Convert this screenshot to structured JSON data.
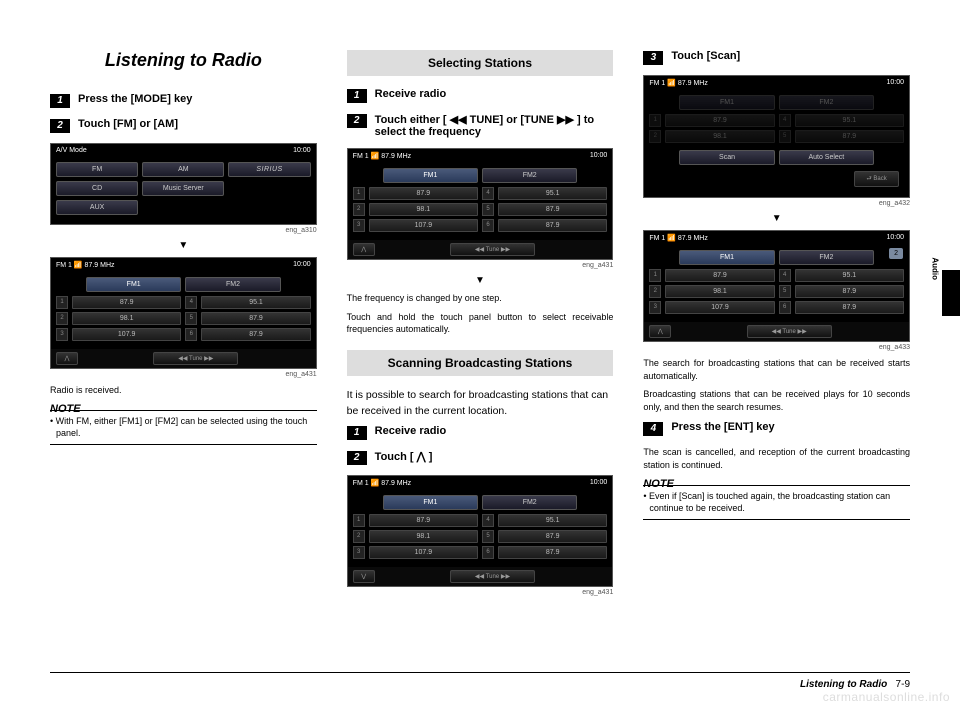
{
  "page": {
    "main_title": "Listening to Radio",
    "footer_title": "Listening to Radio",
    "footer_page": "7-9",
    "side_label": "Audio",
    "watermark": "carmanualsonline.info"
  },
  "col1": {
    "step1": "Press the [MODE] key",
    "step2": "Touch [FM] or [AM]",
    "shot1": {
      "title": "A/V Mode",
      "time": "10:00",
      "btn_fm": "FM",
      "btn_am": "AM",
      "btn_sirius": "SIRIUS",
      "btn_cd": "CD",
      "btn_music": "Music Server",
      "btn_aux": "AUX",
      "caption": "eng_a310"
    },
    "shot2": {
      "title": "FM 1   📶 87.9  MHz",
      "time": "10:00",
      "fm1": "FM1",
      "fm2": "FM2",
      "p1": "87.9",
      "p2": "98.1",
      "p3": "107.9",
      "p4": "95.1",
      "p5": "87.9",
      "p6": "87.9",
      "foot_tune": "◀◀ Tune ▶▶",
      "caption": "eng_a431"
    },
    "received": "Radio is received.",
    "note_label": "NOTE",
    "note_text": "• With FM, either [FM1] or [FM2] can be selected using the touch panel."
  },
  "col2": {
    "section1": "Selecting Stations",
    "s1_step1": "Receive radio",
    "s1_step2": "Touch either [ ◀◀ TUNE] or [TUNE ▶▶ ] to select the frequency",
    "shot1": {
      "title": "FM 1   📶 87.9  MHz",
      "time": "10:00",
      "fm1": "FM1",
      "fm2": "FM2",
      "p1": "87.9",
      "p2": "98.1",
      "p3": "107.9",
      "p4": "95.1",
      "p5": "87.9",
      "p6": "87.9",
      "foot_tune": "◀◀ Tune ▶▶",
      "caption": "eng_a431"
    },
    "s1_text1": "The frequency is changed by one step.",
    "s1_text2": "Touch and hold the touch panel button to select receivable frequencies automatically.",
    "section2": "Scanning Broadcasting Stations",
    "s2_intro": "It is possible to search for broadcasting stations that can be received in the current location.",
    "s2_step1": "Receive radio",
    "s2_step2": "Touch [ ⋀ ]",
    "shot2": {
      "title": "FM 1   📶 87.9  MHz",
      "time": "10:00",
      "fm1": "FM1",
      "fm2": "FM2",
      "p1": "87.9",
      "p2": "98.1",
      "p3": "107.9",
      "p4": "95.1",
      "p5": "87.9",
      "p6": "87.9",
      "foot_tune": "◀◀ Tune ▶▶",
      "caption": "eng_a431"
    }
  },
  "col3": {
    "step3": "Touch [Scan]",
    "shot1": {
      "title": "FM 1   📶 87.9  MHz",
      "time": "10:00",
      "fm1": "FM1",
      "fm2": "FM2",
      "p1": "87.9",
      "p2": "98.1",
      "p4": "95.1",
      "p5": "87.9",
      "scan": "Scan",
      "auto": "Auto Select",
      "back": "⮐ Back",
      "caption": "eng_a432"
    },
    "shot2": {
      "title": "FM 1   📶 87.9  MHz",
      "time": "10:00",
      "fm1": "FM1",
      "fm2": "FM2",
      "p1": "87.9",
      "p2": "98.1",
      "p3": "107.9",
      "p4": "95.1",
      "p5": "87.9",
      "p6": "87.9",
      "foot_tune": "◀◀ Tune ▶▶",
      "caption": "eng_a433",
      "badge": "2"
    },
    "search_text1": "The search for broadcasting stations that can be received starts automatically.",
    "search_text2": "Broadcasting stations that can be received plays for 10 seconds only, and then the search resumes.",
    "step4": "Press the [ENT] key",
    "step4_text": "The scan is cancelled, and reception of the current broadcasting station is continued.",
    "note_label": "NOTE",
    "note_text": "• Even if [Scan] is touched again, the broadcasting station can continue to be received."
  }
}
